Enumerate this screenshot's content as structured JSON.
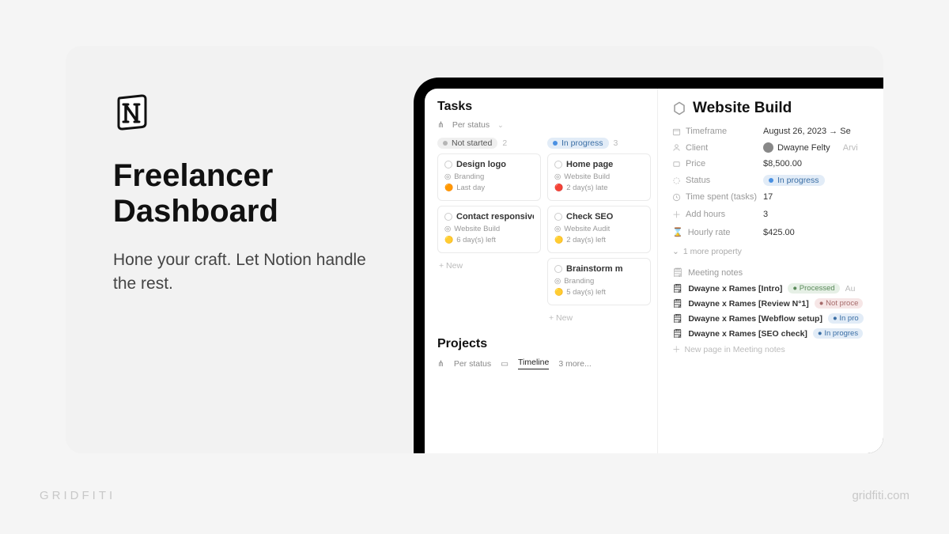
{
  "headline": "Freelancer Dashboard",
  "subline": "Hone your craft. Let Notion handle the rest.",
  "footer": {
    "brand": "GRIDFITI",
    "url": "gridfiti.com"
  },
  "tasks": {
    "title": "Tasks",
    "view": "Per status",
    "columns": [
      {
        "label": "Not started",
        "count": "2",
        "tone": "grey",
        "cards": [
          {
            "title": "Design logo",
            "project": "Branding",
            "due_emoji": "🟠",
            "due": "Last day"
          },
          {
            "title": "Contact responsiveness",
            "project": "Website Build",
            "due_emoji": "🟡",
            "due": "6 day(s) left"
          }
        ],
        "new": "+  New"
      },
      {
        "label": "In progress",
        "count": "3",
        "tone": "blue",
        "cards": [
          {
            "title": "Home page",
            "project": "Website Build",
            "due_emoji": "🔴",
            "due": "2 day(s) late"
          },
          {
            "title": "Check SEO",
            "project": "Website Audit",
            "due_emoji": "🟡",
            "due": "2 day(s) left"
          },
          {
            "title": "Brainstorm m",
            "project": "Branding",
            "due_emoji": "🟡",
            "due": "5 day(s) left"
          }
        ],
        "new": "+  New"
      }
    ]
  },
  "projects": {
    "title": "Projects",
    "tabs": {
      "t1": "Per status",
      "t2": "Timeline",
      "more": "3 more..."
    }
  },
  "detail": {
    "title": "Website Build",
    "props": [
      {
        "icon": "calendar",
        "label": "Timeframe",
        "value": "August 26, 2023 → Se"
      },
      {
        "icon": "person",
        "label": "Client",
        "value": "Dwayne Felty",
        "extra": "Arvi"
      },
      {
        "icon": "price",
        "label": "Price",
        "value": "$8,500.00"
      },
      {
        "icon": "status",
        "label": "Status",
        "value": "In progress",
        "pill": "blue"
      },
      {
        "icon": "clock",
        "label": "Time spent (tasks)",
        "value": "17"
      },
      {
        "icon": "plus",
        "label": "Add hours",
        "value": "3"
      },
      {
        "icon": "hourglass",
        "label": "Hourly rate",
        "value": "$425.00"
      }
    ],
    "more": "1 more property",
    "meeting_notes": {
      "label": "Meeting notes",
      "rows": [
        {
          "title": "Dwayne x Rames [Intro]",
          "tag": "Processed",
          "tone": "green",
          "extra": "Au"
        },
        {
          "title": "Dwayne x Rames [Review N°1]",
          "tag": "Not proce",
          "tone": "red"
        },
        {
          "title": "Dwayne x Rames [Webflow setup]",
          "tag": "In pro",
          "tone": "blue"
        },
        {
          "title": "Dwayne x Rames [SEO check]",
          "tag": "In progres",
          "tone": "blue"
        }
      ],
      "new": "New page in Meeting notes"
    }
  }
}
